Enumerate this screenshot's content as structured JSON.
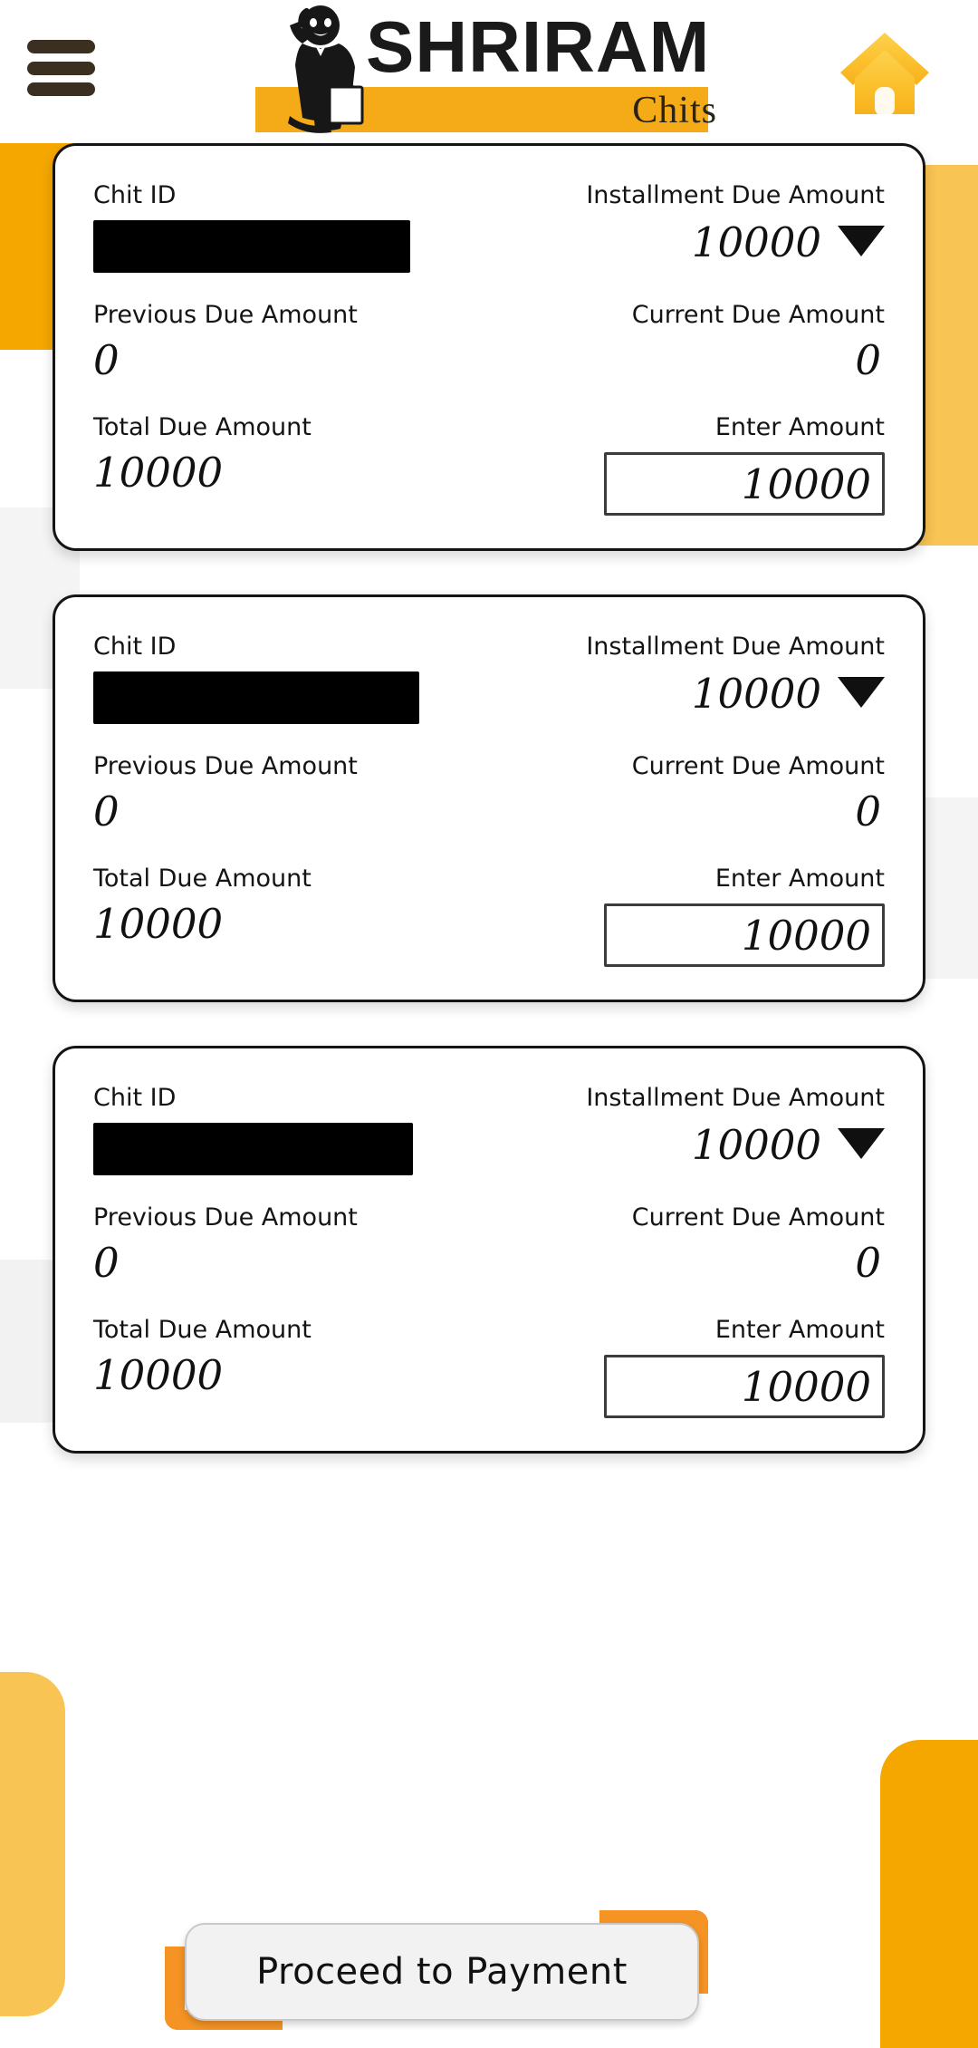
{
  "header": {
    "menu_icon": "hamburger-menu-icon",
    "home_icon": "home-icon",
    "brand_name": "SHRIRAM",
    "brand_sub": "Chits",
    "mascot_icon": "mascot-man-icon"
  },
  "labels": {
    "chit_id": "Chit ID",
    "installment_due": "Installment Due Amount",
    "previous_due": "Previous Due Amount",
    "current_due": "Current Due Amount",
    "total_due": "Total Due Amount",
    "enter_amount": "Enter Amount",
    "dropdown_icon": "chevron-down-icon"
  },
  "cards": [
    {
      "chit_id": "",
      "chit_id_redacted": true,
      "installment_due_amount": "10000",
      "previous_due_amount": "0",
      "current_due_amount": "0",
      "total_due_amount": "10000",
      "enter_amount_value": "10000"
    },
    {
      "chit_id": "",
      "chit_id_redacted": true,
      "installment_due_amount": "10000",
      "previous_due_amount": "0",
      "current_due_amount": "0",
      "total_due_amount": "10000",
      "enter_amount_value": "10000"
    },
    {
      "chit_id": "",
      "chit_id_redacted": true,
      "installment_due_amount": "10000",
      "previous_due_amount": "0",
      "current_due_amount": "0",
      "total_due_amount": "10000",
      "enter_amount_value": "10000"
    }
  ],
  "footer": {
    "proceed_label": "Proceed to Payment"
  },
  "colors": {
    "brand_orange": "#f5a700",
    "brand_amber": "#f5ab17",
    "accent_light_amber": "#f8c453",
    "button_corner_orange": "#f59425",
    "text_dark": "#141414",
    "menu_bar": "#3a2f20"
  }
}
